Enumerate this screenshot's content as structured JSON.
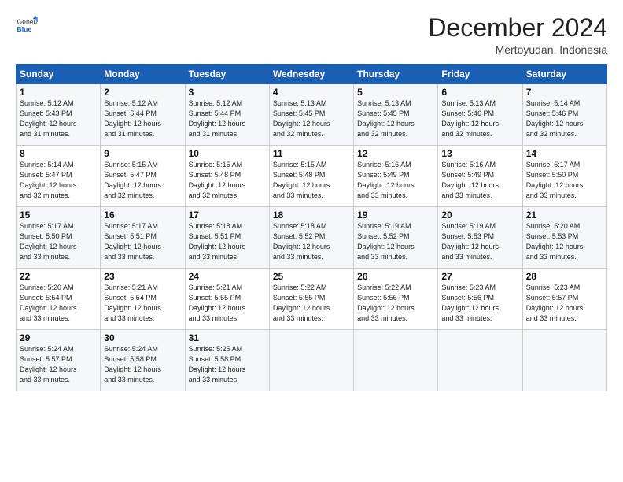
{
  "logo": {
    "general": "General",
    "blue": "Blue"
  },
  "title": "December 2024",
  "location": "Mertoyudan, Indonesia",
  "days_header": [
    "Sunday",
    "Monday",
    "Tuesday",
    "Wednesday",
    "Thursday",
    "Friday",
    "Saturday"
  ],
  "weeks": [
    [
      {
        "day": "1",
        "sunrise": "5:12 AM",
        "sunset": "5:43 PM",
        "daylight": "12 hours and 31 minutes."
      },
      {
        "day": "2",
        "sunrise": "5:12 AM",
        "sunset": "5:44 PM",
        "daylight": "12 hours and 31 minutes."
      },
      {
        "day": "3",
        "sunrise": "5:12 AM",
        "sunset": "5:44 PM",
        "daylight": "12 hours and 31 minutes."
      },
      {
        "day": "4",
        "sunrise": "5:13 AM",
        "sunset": "5:45 PM",
        "daylight": "12 hours and 32 minutes."
      },
      {
        "day": "5",
        "sunrise": "5:13 AM",
        "sunset": "5:45 PM",
        "daylight": "12 hours and 32 minutes."
      },
      {
        "day": "6",
        "sunrise": "5:13 AM",
        "sunset": "5:46 PM",
        "daylight": "12 hours and 32 minutes."
      },
      {
        "day": "7",
        "sunrise": "5:14 AM",
        "sunset": "5:46 PM",
        "daylight": "12 hours and 32 minutes."
      }
    ],
    [
      {
        "day": "8",
        "sunrise": "5:14 AM",
        "sunset": "5:47 PM",
        "daylight": "12 hours and 32 minutes."
      },
      {
        "day": "9",
        "sunrise": "5:15 AM",
        "sunset": "5:47 PM",
        "daylight": "12 hours and 32 minutes."
      },
      {
        "day": "10",
        "sunrise": "5:15 AM",
        "sunset": "5:48 PM",
        "daylight": "12 hours and 32 minutes."
      },
      {
        "day": "11",
        "sunrise": "5:15 AM",
        "sunset": "5:48 PM",
        "daylight": "12 hours and 33 minutes."
      },
      {
        "day": "12",
        "sunrise": "5:16 AM",
        "sunset": "5:49 PM",
        "daylight": "12 hours and 33 minutes."
      },
      {
        "day": "13",
        "sunrise": "5:16 AM",
        "sunset": "5:49 PM",
        "daylight": "12 hours and 33 minutes."
      },
      {
        "day": "14",
        "sunrise": "5:17 AM",
        "sunset": "5:50 PM",
        "daylight": "12 hours and 33 minutes."
      }
    ],
    [
      {
        "day": "15",
        "sunrise": "5:17 AM",
        "sunset": "5:50 PM",
        "daylight": "12 hours and 33 minutes."
      },
      {
        "day": "16",
        "sunrise": "5:17 AM",
        "sunset": "5:51 PM",
        "daylight": "12 hours and 33 minutes."
      },
      {
        "day": "17",
        "sunrise": "5:18 AM",
        "sunset": "5:51 PM",
        "daylight": "12 hours and 33 minutes."
      },
      {
        "day": "18",
        "sunrise": "5:18 AM",
        "sunset": "5:52 PM",
        "daylight": "12 hours and 33 minutes."
      },
      {
        "day": "19",
        "sunrise": "5:19 AM",
        "sunset": "5:52 PM",
        "daylight": "12 hours and 33 minutes."
      },
      {
        "day": "20",
        "sunrise": "5:19 AM",
        "sunset": "5:53 PM",
        "daylight": "12 hours and 33 minutes."
      },
      {
        "day": "21",
        "sunrise": "5:20 AM",
        "sunset": "5:53 PM",
        "daylight": "12 hours and 33 minutes."
      }
    ],
    [
      {
        "day": "22",
        "sunrise": "5:20 AM",
        "sunset": "5:54 PM",
        "daylight": "12 hours and 33 minutes."
      },
      {
        "day": "23",
        "sunrise": "5:21 AM",
        "sunset": "5:54 PM",
        "daylight": "12 hours and 33 minutes."
      },
      {
        "day": "24",
        "sunrise": "5:21 AM",
        "sunset": "5:55 PM",
        "daylight": "12 hours and 33 minutes."
      },
      {
        "day": "25",
        "sunrise": "5:22 AM",
        "sunset": "5:55 PM",
        "daylight": "12 hours and 33 minutes."
      },
      {
        "day": "26",
        "sunrise": "5:22 AM",
        "sunset": "5:56 PM",
        "daylight": "12 hours and 33 minutes."
      },
      {
        "day": "27",
        "sunrise": "5:23 AM",
        "sunset": "5:56 PM",
        "daylight": "12 hours and 33 minutes."
      },
      {
        "day": "28",
        "sunrise": "5:23 AM",
        "sunset": "5:57 PM",
        "daylight": "12 hours and 33 minutes."
      }
    ],
    [
      {
        "day": "29",
        "sunrise": "5:24 AM",
        "sunset": "5:57 PM",
        "daylight": "12 hours and 33 minutes."
      },
      {
        "day": "30",
        "sunrise": "5:24 AM",
        "sunset": "5:58 PM",
        "daylight": "12 hours and 33 minutes."
      },
      {
        "day": "31",
        "sunrise": "5:25 AM",
        "sunset": "5:58 PM",
        "daylight": "12 hours and 33 minutes."
      },
      null,
      null,
      null,
      null
    ]
  ],
  "labels": {
    "sunrise": "Sunrise:",
    "sunset": "Sunset:",
    "daylight": "Daylight:"
  }
}
